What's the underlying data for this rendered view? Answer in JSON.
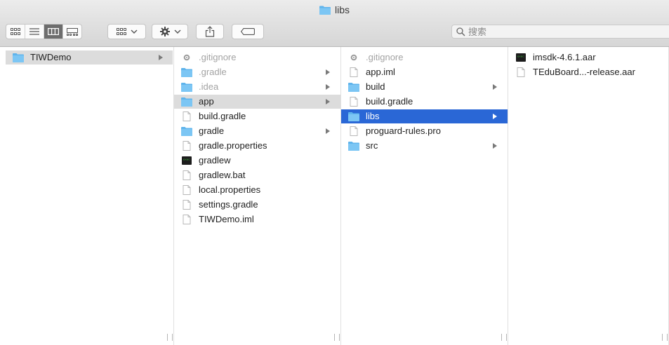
{
  "window": {
    "title": "libs"
  },
  "toolbar": {
    "view_modes": [
      "icon-view",
      "list-view",
      "column-view",
      "gallery-view"
    ],
    "active_view": "column-view",
    "search_placeholder": "搜索"
  },
  "columns": [
    {
      "items": [
        {
          "name": "TIWDemo",
          "kind": "folder",
          "has_children": true,
          "selected": "gray"
        }
      ]
    },
    {
      "items": [
        {
          "name": ".gitignore",
          "kind": "settings",
          "dim": true
        },
        {
          "name": ".gradle",
          "kind": "folder",
          "dim": true,
          "has_children": true
        },
        {
          "name": ".idea",
          "kind": "folder",
          "dim": true,
          "has_children": true
        },
        {
          "name": "app",
          "kind": "folder",
          "has_children": true,
          "selected": "gray"
        },
        {
          "name": "build.gradle",
          "kind": "file"
        },
        {
          "name": "gradle",
          "kind": "folder",
          "has_children": true
        },
        {
          "name": "gradle.properties",
          "kind": "file"
        },
        {
          "name": "gradlew",
          "kind": "exec"
        },
        {
          "name": "gradlew.bat",
          "kind": "file"
        },
        {
          "name": "local.properties",
          "kind": "file"
        },
        {
          "name": "settings.gradle",
          "kind": "file"
        },
        {
          "name": "TIWDemo.iml",
          "kind": "file"
        }
      ]
    },
    {
      "items": [
        {
          "name": ".gitignore",
          "kind": "settings",
          "dim": true
        },
        {
          "name": "app.iml",
          "kind": "file"
        },
        {
          "name": "build",
          "kind": "folder",
          "has_children": true
        },
        {
          "name": "build.gradle",
          "kind": "file"
        },
        {
          "name": "libs",
          "kind": "folder",
          "has_children": true,
          "selected": "blue"
        },
        {
          "name": "proguard-rules.pro",
          "kind": "file"
        },
        {
          "name": "src",
          "kind": "folder",
          "has_children": true
        }
      ]
    },
    {
      "items": [
        {
          "name": "imsdk-4.6.1.aar",
          "kind": "exec"
        },
        {
          "name": "TEduBoard...-release.aar",
          "kind": "file"
        }
      ]
    }
  ]
}
